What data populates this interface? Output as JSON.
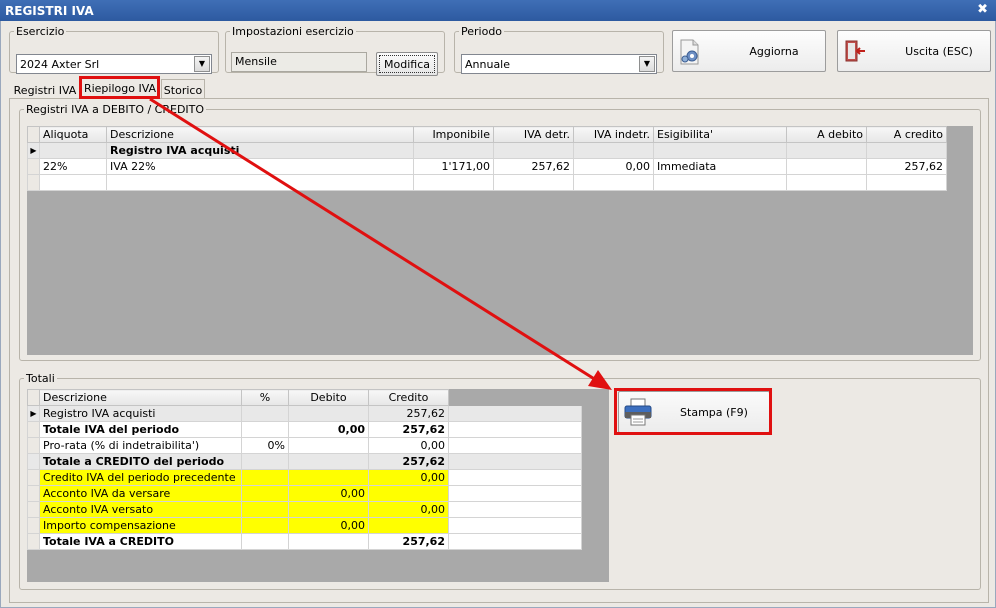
{
  "window": {
    "title": "REGISTRI IVA",
    "close_glyph": "✖"
  },
  "toolbar": {
    "esercizio_label": "Esercizio",
    "esercizio_value": "2024 Axter Srl",
    "impostazioni_label": "Impostazioni esercizio",
    "impostazioni_value": "Mensile",
    "modifica_label": "Modifica",
    "periodo_label": "Periodo",
    "periodo_value": "Annuale",
    "aggiorna_label": "Aggiorna",
    "uscita_label": "Uscita (ESC)"
  },
  "tabs": [
    {
      "label": "Registri IVA"
    },
    {
      "label": "Riepilogo IVA"
    },
    {
      "label": "Storico"
    }
  ],
  "registri": {
    "group_label": "Registri IVA a DEBITO / CREDITO",
    "columns": [
      "Aliquota",
      "Descrizione",
      "Imponibile",
      "IVA detr.",
      "IVA indetr.",
      "Esigibilita'",
      "A debito",
      "A credito"
    ],
    "rows": [
      {
        "aliquota": "",
        "descrizione": "Registro IVA acquisti",
        "imponibile": "",
        "iva_detr": "",
        "iva_indetr": "",
        "esigibilita": "",
        "a_debito": "",
        "a_credito": ""
      },
      {
        "aliquota": "22%",
        "descrizione": "IVA 22%",
        "imponibile": "1'171,00",
        "iva_detr": "257,62",
        "iva_indetr": "0,00",
        "esigibilita": "Immediata",
        "a_debito": "",
        "a_credito": "257,62"
      }
    ]
  },
  "totali": {
    "group_label": "Totali",
    "columns": [
      "Descrizione",
      "%",
      "Debito",
      "Credito"
    ],
    "rows": [
      {
        "descrizione": "Registro IVA acquisti",
        "perc": "",
        "debito": "",
        "credito": "257,62"
      },
      {
        "descrizione": "Totale IVA del periodo",
        "perc": "",
        "debito": "0,00",
        "credito": "257,62"
      },
      {
        "descrizione": "Pro-rata (% di indetraibilita')",
        "perc": "0%",
        "debito": "",
        "credito": "0,00"
      },
      {
        "descrizione": "Totale a CREDITO del periodo",
        "perc": "",
        "debito": "",
        "credito": "257,62"
      },
      {
        "descrizione": "Credito IVA del periodo precedente",
        "perc": "",
        "debito": "",
        "credito": "0,00"
      },
      {
        "descrizione": "Acconto IVA da versare",
        "perc": "",
        "debito": "0,00",
        "credito": ""
      },
      {
        "descrizione": "Acconto IVA versato",
        "perc": "",
        "debito": "",
        "credito": "0,00"
      },
      {
        "descrizione": "Importo compensazione",
        "perc": "",
        "debito": "0,00",
        "credito": ""
      },
      {
        "descrizione": "Totale IVA a CREDITO",
        "perc": "",
        "debito": "",
        "credito": "257,62"
      }
    ]
  },
  "stampa_label": "Stampa (F9)",
  "colors": {
    "annotation_red": "#e01010",
    "highlight_yellow": "#ffff00",
    "title_blue": "#2d5aa0"
  },
  "icons": {
    "aggiorna": "refresh-gear-icon",
    "uscita": "exit-door-icon",
    "stampa": "printer-icon",
    "row_pointer": "row-pointer-icon"
  }
}
